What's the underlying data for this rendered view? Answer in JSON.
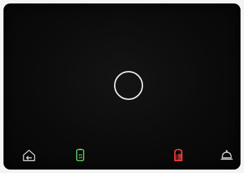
{
  "panel": {
    "center_control": {
      "icon": "ring-icon"
    },
    "bottom_bar": {
      "home": {
        "icon": "home-back-icon"
      },
      "green_key": {
        "icon": "green-key-icon",
        "label": "13",
        "color": "#5fcf5f"
      },
      "red_key": {
        "icon": "red-key-icon",
        "label": "END",
        "color": "#ff3a3a"
      },
      "bell": {
        "icon": "service-bell-icon"
      }
    }
  }
}
